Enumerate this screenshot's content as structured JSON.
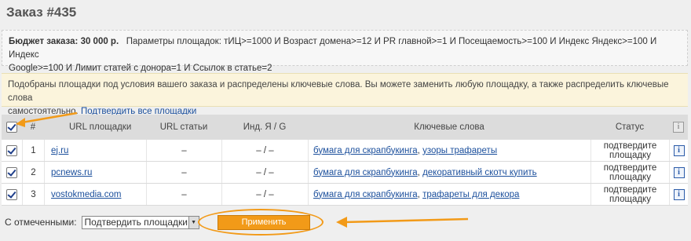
{
  "page_title": "Заказ #435",
  "budget": {
    "label": "Бюджет заказа:",
    "amount": "30 000 р.",
    "params_line1": "Параметры площадок: тИЦ>=1000 И Возраст домена>=12 И PR главной>=1 И Посещаемость>=100 И Индекс Яндекс>=100 И Индекс",
    "params_line2": "Google>=100 И Лимит статей с донора=1 И Ссылок в статье=2"
  },
  "notice": {
    "text_line1": "Подобраны площадки под условия вашего заказа и распределены ключевые слова. Вы можете заменить любую площадку, а также распределить ключевые слова",
    "text_line2": "самостоятельно.",
    "link": "Подтвердить все площадки"
  },
  "table": {
    "headers": {
      "num": "#",
      "url": "URL площадки",
      "article": "URL статьи",
      "index": "Инд. Я / G",
      "keywords": "Ключевые слова",
      "status": "Статус"
    },
    "rows": [
      {
        "num": "1",
        "url": "ej.ru",
        "article": "–",
        "index": "– / –",
        "kw1": "бумага для скрапбукинга",
        "sep": ",",
        "kw2": "узоры трафареты",
        "status": "подтвердите площадку"
      },
      {
        "num": "2",
        "url": "pcnews.ru",
        "article": "–",
        "index": "– / –",
        "kw1": "бумага для скрапбукинга",
        "sep": ",",
        "kw2": "декоративный скотч купить",
        "status": "подтвердите площадку"
      },
      {
        "num": "3",
        "url": "vostokmedia.com",
        "article": "–",
        "index": "– / –",
        "kw1": "бумага для скрапбукинга",
        "sep": ",",
        "kw2": "трафареты для декора",
        "status": "подтвердите площадку"
      }
    ]
  },
  "bulk": {
    "label": "С отмеченными:",
    "selected_option": "Подтвердить площадки",
    "apply_label": "Применить"
  },
  "colors": {
    "accent": "#f29a18",
    "link": "#1b4f9c",
    "notice_bg": "#fbf4dc"
  },
  "icons": {
    "info": "info-icon",
    "check": "checkbox-checked"
  }
}
